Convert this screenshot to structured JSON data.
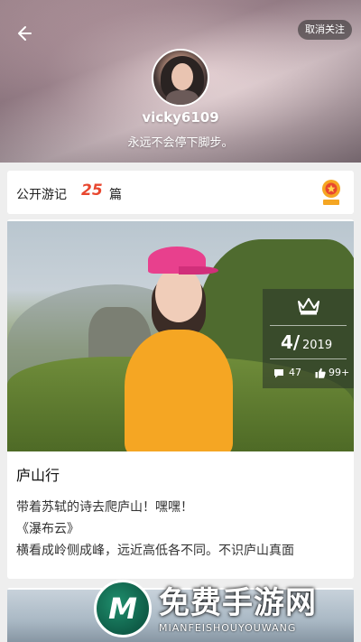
{
  "header": {
    "unfollow_label": "取消关注",
    "username": "vicky6109",
    "motto": "永远不会停下脚步。"
  },
  "count_bar": {
    "label": "公开游记",
    "count": "25",
    "unit": "篇"
  },
  "card": {
    "date_day": "4/",
    "date_year": "2019",
    "comments": "47",
    "likes": "99+",
    "title": "庐山行",
    "lines": [
      "带着苏轼的诗去爬庐山！嘿嘿！",
      "《瀑布云》",
      "横看成岭侧成峰，远近高低各不同。不识庐山真面"
    ]
  },
  "watermark": {
    "logo_letter": "M",
    "name": "免费手游网",
    "sub": "MIANFEISHOUYOUWANG"
  },
  "colors": {
    "accent": "#e8472f",
    "badge_bg": "#283228",
    "watermark_green": "#0f5c47"
  }
}
